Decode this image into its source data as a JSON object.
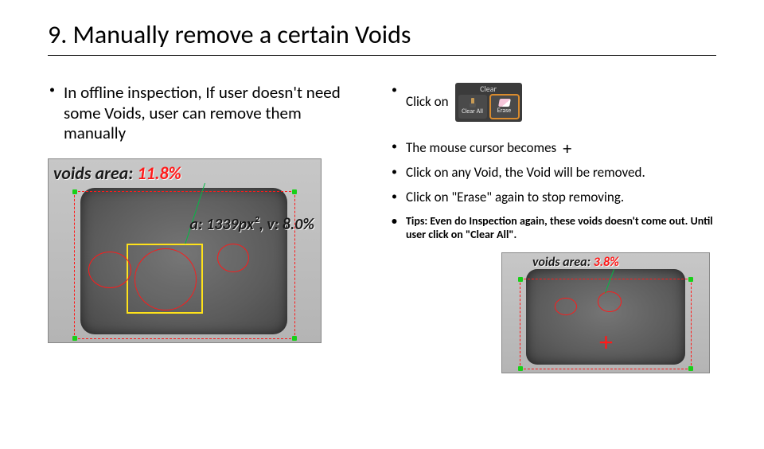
{
  "title": "9. Manually remove a certain Voids",
  "left": {
    "intro": "In offline inspection, If user doesn't need some Voids, user can remove them manually",
    "shot": {
      "voids_area_label": "voids area:",
      "voids_area_value": "11.8%",
      "annot": "a: 1339px², v: 8.0%"
    }
  },
  "right": {
    "bullet_click_on": "Click on",
    "toolbar": {
      "header": "Clear",
      "btn1": "Clear All",
      "btn2": "Erase"
    },
    "bullet_cursor": "The mouse cursor becomes",
    "cursor_glyph": "+",
    "bullet_remove": "Click on any Void, the Void will be removed.",
    "bullet_stop": "Click on \"Erase\" again to stop removing.",
    "bullet_tip": "Tips: Even do Inspection again, these voids doesn't come out. Until user click on \"Clear All\".",
    "shot": {
      "voids_area_label": "voids area:",
      "voids_area_value": "3.8%",
      "plus": "+"
    }
  }
}
